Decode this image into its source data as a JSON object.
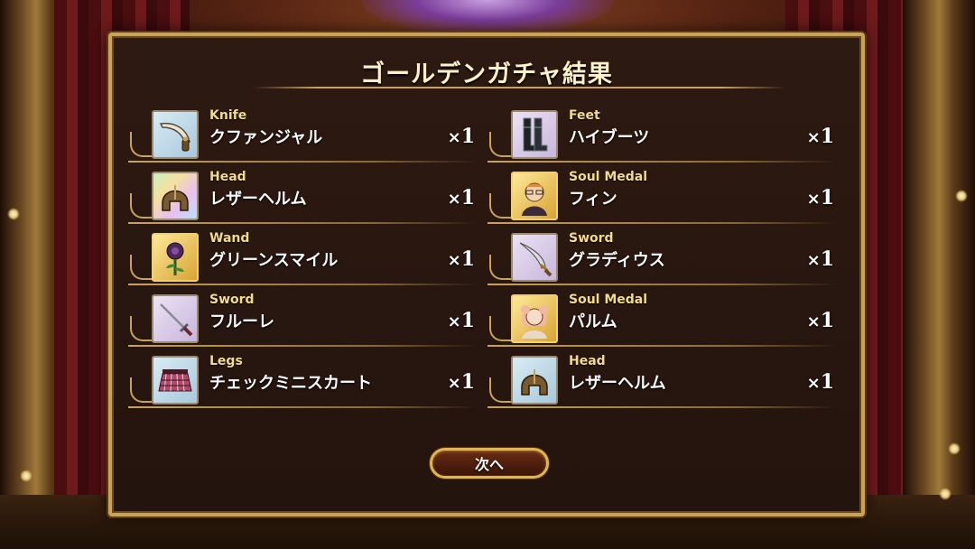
{
  "dialog": {
    "title": "ゴールデンガチャ結果",
    "next_label": "次へ"
  },
  "results": [
    {
      "type": "Knife",
      "name": "クファンジャル",
      "times": "×",
      "count": "1",
      "icon": "knife-icon"
    },
    {
      "type": "Feet",
      "name": "ハイブーツ",
      "times": "×",
      "count": "1",
      "icon": "boots-icon"
    },
    {
      "type": "Head",
      "name": "レザーヘルム",
      "times": "×",
      "count": "1",
      "icon": "helmet-icon"
    },
    {
      "type": "Soul Medal",
      "name": "フィン",
      "times": "×",
      "count": "1",
      "icon": "soul-medal-portrait-icon"
    },
    {
      "type": "Wand",
      "name": "グリーンスマイル",
      "times": "×",
      "count": "1",
      "icon": "rose-wand-icon"
    },
    {
      "type": "Sword",
      "name": "グラディウス",
      "times": "×",
      "count": "1",
      "icon": "scimitar-icon"
    },
    {
      "type": "Sword",
      "name": "フルーレ",
      "times": "×",
      "count": "1",
      "icon": "rapier-icon"
    },
    {
      "type": "Soul Medal",
      "name": "パルム",
      "times": "×",
      "count": "1",
      "icon": "soul-medal-portrait-icon"
    },
    {
      "type": "Legs",
      "name": "チェックミニスカート",
      "times": "×",
      "count": "1",
      "icon": "skirt-icon"
    },
    {
      "type": "Head",
      "name": "レザーヘルム",
      "times": "×",
      "count": "1",
      "icon": "helmet-icon"
    }
  ],
  "colors": {
    "frame_gold": "#c9a35a",
    "panel_bg": "#2d1a12",
    "type_text": "#f2dc8c",
    "title_text": "#fff1c8"
  }
}
